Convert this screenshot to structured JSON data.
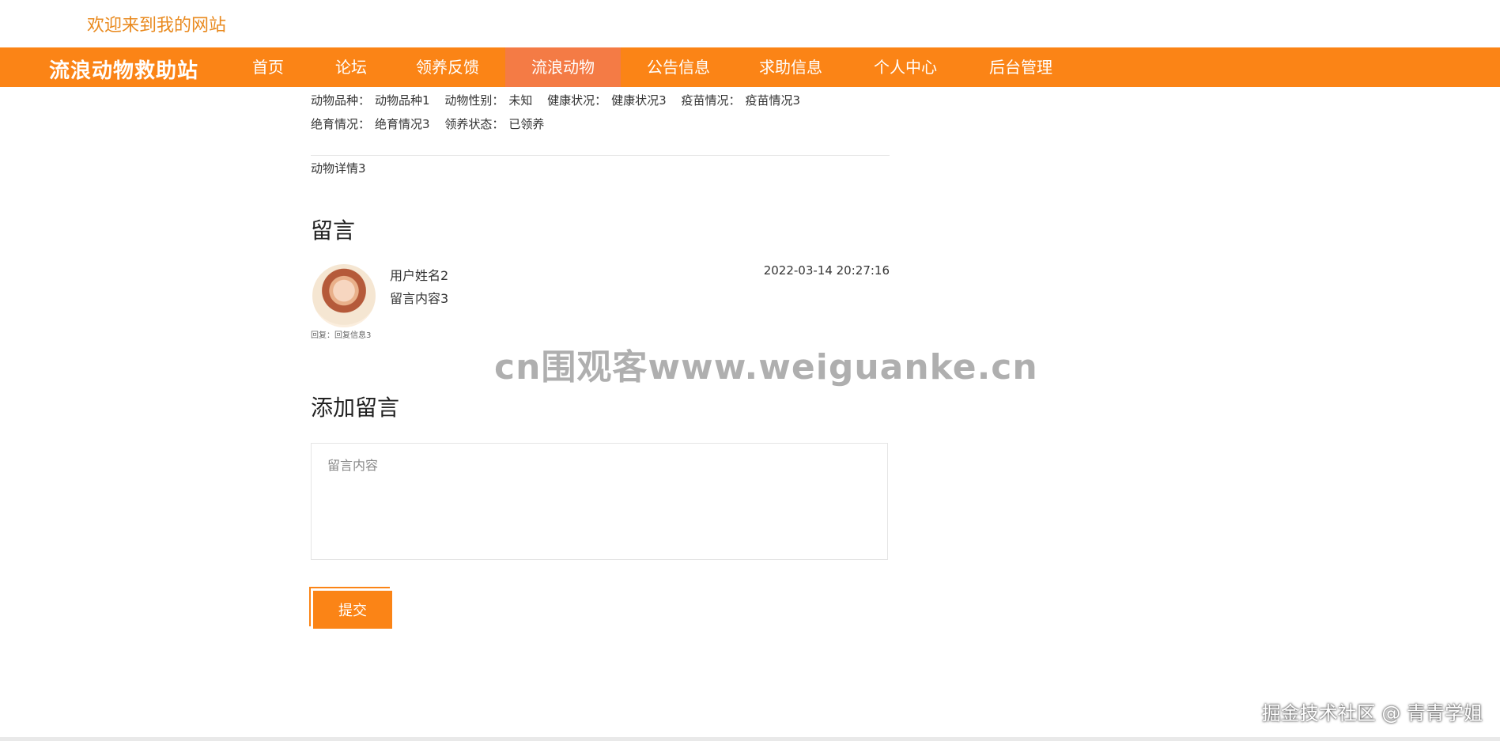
{
  "header": {
    "welcome": "欢迎来到我的网站"
  },
  "nav": {
    "brand": "流浪动物救助站",
    "items": [
      {
        "label": "首页",
        "active": false
      },
      {
        "label": "论坛",
        "active": false
      },
      {
        "label": "领养反馈",
        "active": false
      },
      {
        "label": "流浪动物",
        "active": true
      },
      {
        "label": "公告信息",
        "active": false
      },
      {
        "label": "求助信息",
        "active": false
      },
      {
        "label": "个人中心",
        "active": false
      },
      {
        "label": "后台管理",
        "active": false
      }
    ]
  },
  "animal": {
    "breed_label": "动物品种：",
    "breed": "动物品种1",
    "gender_label": "动物性别：",
    "gender": "未知",
    "health_label": "健康状况：",
    "health": "健康状况3",
    "vaccine_label": "疫苗情况：",
    "vaccine": "疫苗情况3",
    "sterilize_label": "绝育情况：",
    "sterilize": "绝育情况3",
    "adopt_label": "领养状态：",
    "adopt": "已领养",
    "detail": "动物详情3"
  },
  "comments": {
    "title": "留言",
    "items": [
      {
        "user": "用户姓名2",
        "content": "留言内容3",
        "time": "2022-03-14 20:27:16",
        "reply": "回复：回复信息3"
      }
    ]
  },
  "add_comment": {
    "title": "添加留言",
    "placeholder": "留言内容",
    "submit_label": "提交"
  },
  "watermark": "cn围观客www.weiguanke.cn",
  "footer": {
    "credit": "掘金技术社区 @ 青青学姐"
  },
  "colors": {
    "nav_bg": "#fb8416",
    "nav_active": "#f47b45",
    "welcome": "#e98a1f"
  }
}
